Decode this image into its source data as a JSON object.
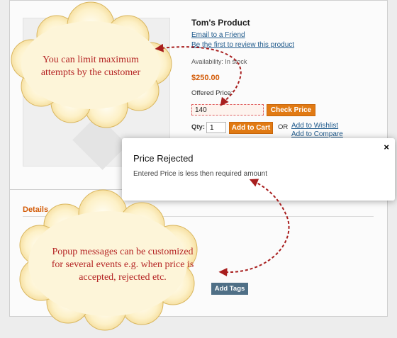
{
  "product": {
    "title": "Tom's Product",
    "email_link": "Email to a Friend",
    "review_link": "Be the first to review this product",
    "availability": "Availability: In stock",
    "price": "$250.00",
    "offered_price_label": "Offered Price:",
    "offered_price_value": "140",
    "check_price_button": "Check Price",
    "qty_label": "Qty:",
    "qty_value": "1",
    "add_to_cart_button": "Add to Cart",
    "or_label": "OR",
    "wishlist_link": "Add to Wishlist",
    "compare_link": "Add to Compare"
  },
  "details": {
    "heading": "Details",
    "tags_button": "Add Tags"
  },
  "modal": {
    "title": "Price Rejected",
    "message": "Entered Price is less then required amount",
    "close_symbol": "×"
  },
  "callouts": {
    "top": "You can limit maximum attempts by the customer",
    "bottom": "Popup messages can be customized for several events e.g. when price is accepted, rejected etc."
  },
  "colors": {
    "accent_orange": "#e17a13",
    "price_orange": "#d35b07",
    "link_blue": "#1f5a8c",
    "callout_text": "#b52525",
    "cloud_fill": "#fbeab2"
  }
}
